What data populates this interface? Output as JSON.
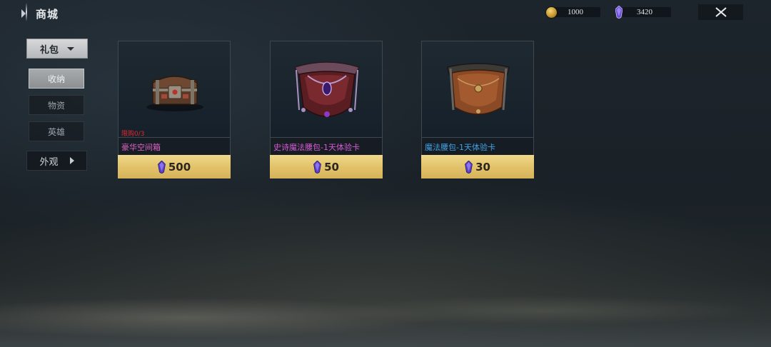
{
  "header": {
    "title": "商城"
  },
  "currencies": [
    {
      "icon": "gold-coin-icon",
      "value": "1000"
    },
    {
      "icon": "purple-gem-icon",
      "value": "3420"
    }
  ],
  "nav": {
    "dropdown_label": "礼包",
    "sub_items": [
      {
        "label": "收纳",
        "active": true
      },
      {
        "label": "物资",
        "active": false
      },
      {
        "label": "英雄",
        "active": false
      }
    ],
    "collapsed_category": "外观"
  },
  "products": [
    {
      "name": "豪华空间箱",
      "name_color": "#e064c8",
      "limit": "限购0/3",
      "price": "500",
      "price_icon": "purple-gem-icon",
      "art_icon": "treasure-chest-icon"
    },
    {
      "name": "史诗魔法腰包-1天体验卡",
      "name_color": "#d65ad6",
      "limit": "",
      "price": "50",
      "price_icon": "purple-gem-icon",
      "art_icon": "epic-waist-pouch-icon"
    },
    {
      "name": "魔法腰包-1天体验卡",
      "name_color": "#3fa3e6",
      "limit": "",
      "price": "30",
      "price_icon": "purple-gem-icon",
      "art_icon": "leather-waist-pouch-icon"
    }
  ],
  "colors": {
    "price_bar": "#e3c36a",
    "limit_text": "#e0282e",
    "gem": "#6a4fd6"
  }
}
